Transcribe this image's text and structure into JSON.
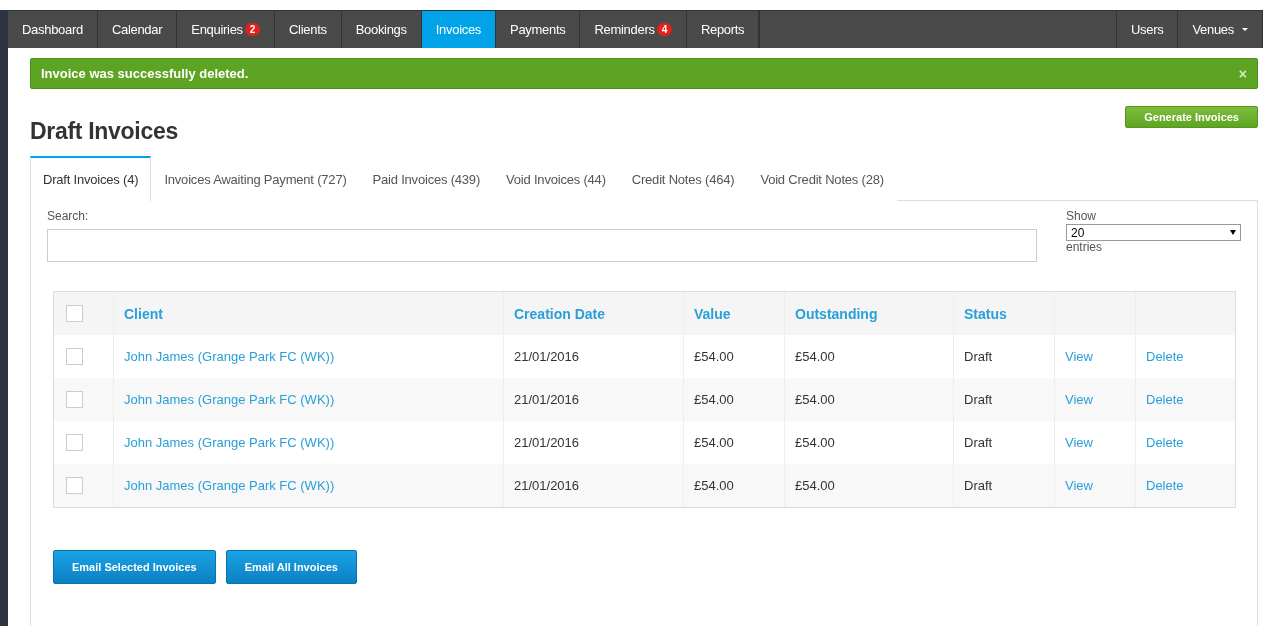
{
  "nav": {
    "left": [
      {
        "label": "Dashboard",
        "selected": false
      },
      {
        "label": "Calendar",
        "selected": false
      },
      {
        "label": "Enquiries",
        "badge": "2",
        "selected": false
      },
      {
        "label": "Clients",
        "selected": false
      },
      {
        "label": "Bookings",
        "selected": false
      },
      {
        "label": "Invoices",
        "selected": true
      },
      {
        "label": "Payments",
        "selected": false
      },
      {
        "label": "Reminders",
        "badge": "4",
        "selected": false
      },
      {
        "label": "Reports",
        "selected": false
      }
    ],
    "right": [
      {
        "label": "Users",
        "selected": false
      },
      {
        "label": "Venues",
        "dropdown": true,
        "selected": false
      }
    ]
  },
  "alert": {
    "message": "Invoice was successfully deleted.",
    "close": "×"
  },
  "page_title": "Draft Invoices",
  "generate_button": "Generate Invoices",
  "tabs": [
    {
      "label": "Draft Invoices (4)",
      "selected": true
    },
    {
      "label": "Invoices Awaiting Payment (727)",
      "selected": false
    },
    {
      "label": "Paid Invoices (439)",
      "selected": false
    },
    {
      "label": "Void Invoices (44)",
      "selected": false
    },
    {
      "label": "Credit Notes (464)",
      "selected": false
    },
    {
      "label": "Void Credit Notes (28)",
      "selected": false
    }
  ],
  "search": {
    "label": "Search:"
  },
  "show": {
    "label": "Show",
    "value": "20",
    "suffix": "entries"
  },
  "table": {
    "select_all_checked": false,
    "columns": [
      "Client",
      "Creation Date",
      "Value",
      "Outstanding",
      "Status"
    ],
    "rows": [
      {
        "checked": false,
        "client": "John James (Grange Park FC (WK))",
        "date": "21/01/2016",
        "value": "£54.00",
        "outstanding": "£54.00",
        "status": "Draft",
        "view": "View",
        "delete": "Delete"
      },
      {
        "checked": false,
        "client": "John James (Grange Park FC (WK))",
        "date": "21/01/2016",
        "value": "£54.00",
        "outstanding": "£54.00",
        "status": "Draft",
        "view": "View",
        "delete": "Delete"
      },
      {
        "checked": false,
        "client": "John James (Grange Park FC (WK))",
        "date": "21/01/2016",
        "value": "£54.00",
        "outstanding": "£54.00",
        "status": "Draft",
        "view": "View",
        "delete": "Delete"
      },
      {
        "checked": false,
        "client": "John James (Grange Park FC (WK))",
        "date": "21/01/2016",
        "value": "£54.00",
        "outstanding": "£54.00",
        "status": "Draft",
        "view": "View",
        "delete": "Delete"
      }
    ]
  },
  "buttons": [
    "Email Selected Invoices",
    "Email All Invoices"
  ]
}
